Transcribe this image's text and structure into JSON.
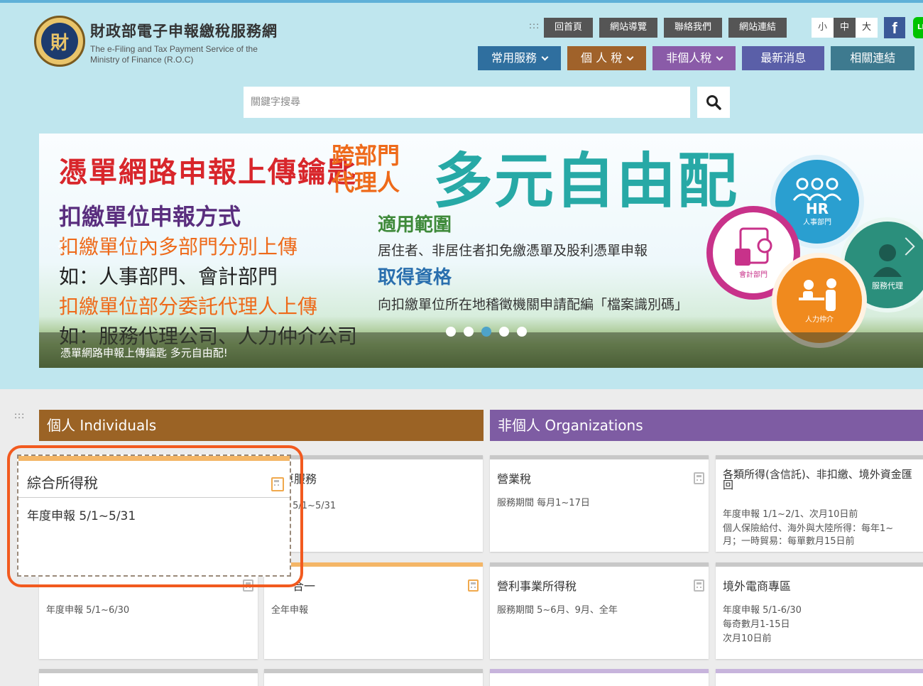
{
  "header": {
    "title": "財政部電子申報繳稅服務網",
    "subtitle_line1": "The e-Filing and Tax Payment Service of the",
    "subtitle_line2": "Ministry of Finance (R.O.C)",
    "logo_icon": "mof-emblem-icon",
    "top_links": [
      "回首頁",
      "網站導覽",
      "聯絡我們",
      "網站連結"
    ],
    "font_sizes": [
      "小",
      "中",
      "大"
    ],
    "facebook_label": "f",
    "line_label": "LINE"
  },
  "nav": {
    "items": [
      {
        "label": "常用服務",
        "color": "#2f6f9f",
        "dropdown": true
      },
      {
        "label": "個 人 稅",
        "color": "#a0622a",
        "dropdown": true
      },
      {
        "label": "非個人稅",
        "color": "#8a5ba8",
        "dropdown": true
      },
      {
        "label": "最新消息",
        "color": "#5a5fa8",
        "dropdown": false
      },
      {
        "label": "相關連結",
        "color": "#3e7a8f",
        "dropdown": false
      }
    ]
  },
  "search": {
    "placeholder": "關鍵字搜尋",
    "button_icon": "search-icon"
  },
  "banner": {
    "headline": "憑單網路申報上傳鑰匙",
    "tag_line1": "跨部門",
    "tag_line2": "代理人",
    "big_title": "多元自由配",
    "method_title": "扣繳單位申報方式",
    "method_1": "扣繳單位內多部門分別上傳",
    "method_1_eg": "如：人事部門、會計部門",
    "method_2": "扣繳單位部分委託代理人上傳",
    "method_2_eg": "如：服務代理公司、人力仲介公司",
    "scope_title": "適用範圍",
    "scope_text": "居住者、非居住者扣免繳憑單及股利憑單申報",
    "qualify_title": "取得資格",
    "qualify_text": "向扣繳單位所在地稽徵機關申請配編「檔案識別碼」",
    "circle_hr": "HR",
    "circle_hr_sub": "人事部門",
    "circle_acct": "會計部門",
    "circle_agent": "服務代理",
    "circle_labor": "人力仲介",
    "caption": "憑單網路申報上傳鑰匙 多元自由配!",
    "slide_count": 5,
    "active_slide": 3
  },
  "sections": {
    "individuals": {
      "label": "個人 Individuals",
      "color": "#9b6325"
    },
    "organizations": {
      "label": "非個人 Organizations",
      "color": "#7e5ca3"
    }
  },
  "cards": {
    "focus": {
      "title": "綜合所得稅",
      "desc": "年度申報 5/1~5/31"
    },
    "c1": {
      "title": "試算服務",
      "desc": "申報 5/1~5/31"
    },
    "c2": {
      "title": "營業稅",
      "desc": "服務期間 每月1~17日"
    },
    "c3": {
      "title": "各類所得(含信託)、非扣繳、境外資金匯回",
      "desc1": "年度申報 1/1~2/1、次月10日前",
      "desc2": "個人保險給付、海外與大陸所得：每年1~",
      "desc3": "月；一時貿易：每單數月15日前"
    },
    "c4": {
      "title": "",
      "desc": "年度申報 5/1~6/30"
    },
    "c5": {
      "title": "合一",
      "desc": "全年申報"
    },
    "c6": {
      "title": "營利事業所得稅",
      "desc": "服務期間 5~6月、9月、全年"
    },
    "c7": {
      "title": "境外電商專區",
      "desc1": "年度申報 5/1-6/30",
      "desc2": "每奇數月1-15日",
      "desc3": "次月10日前"
    }
  }
}
